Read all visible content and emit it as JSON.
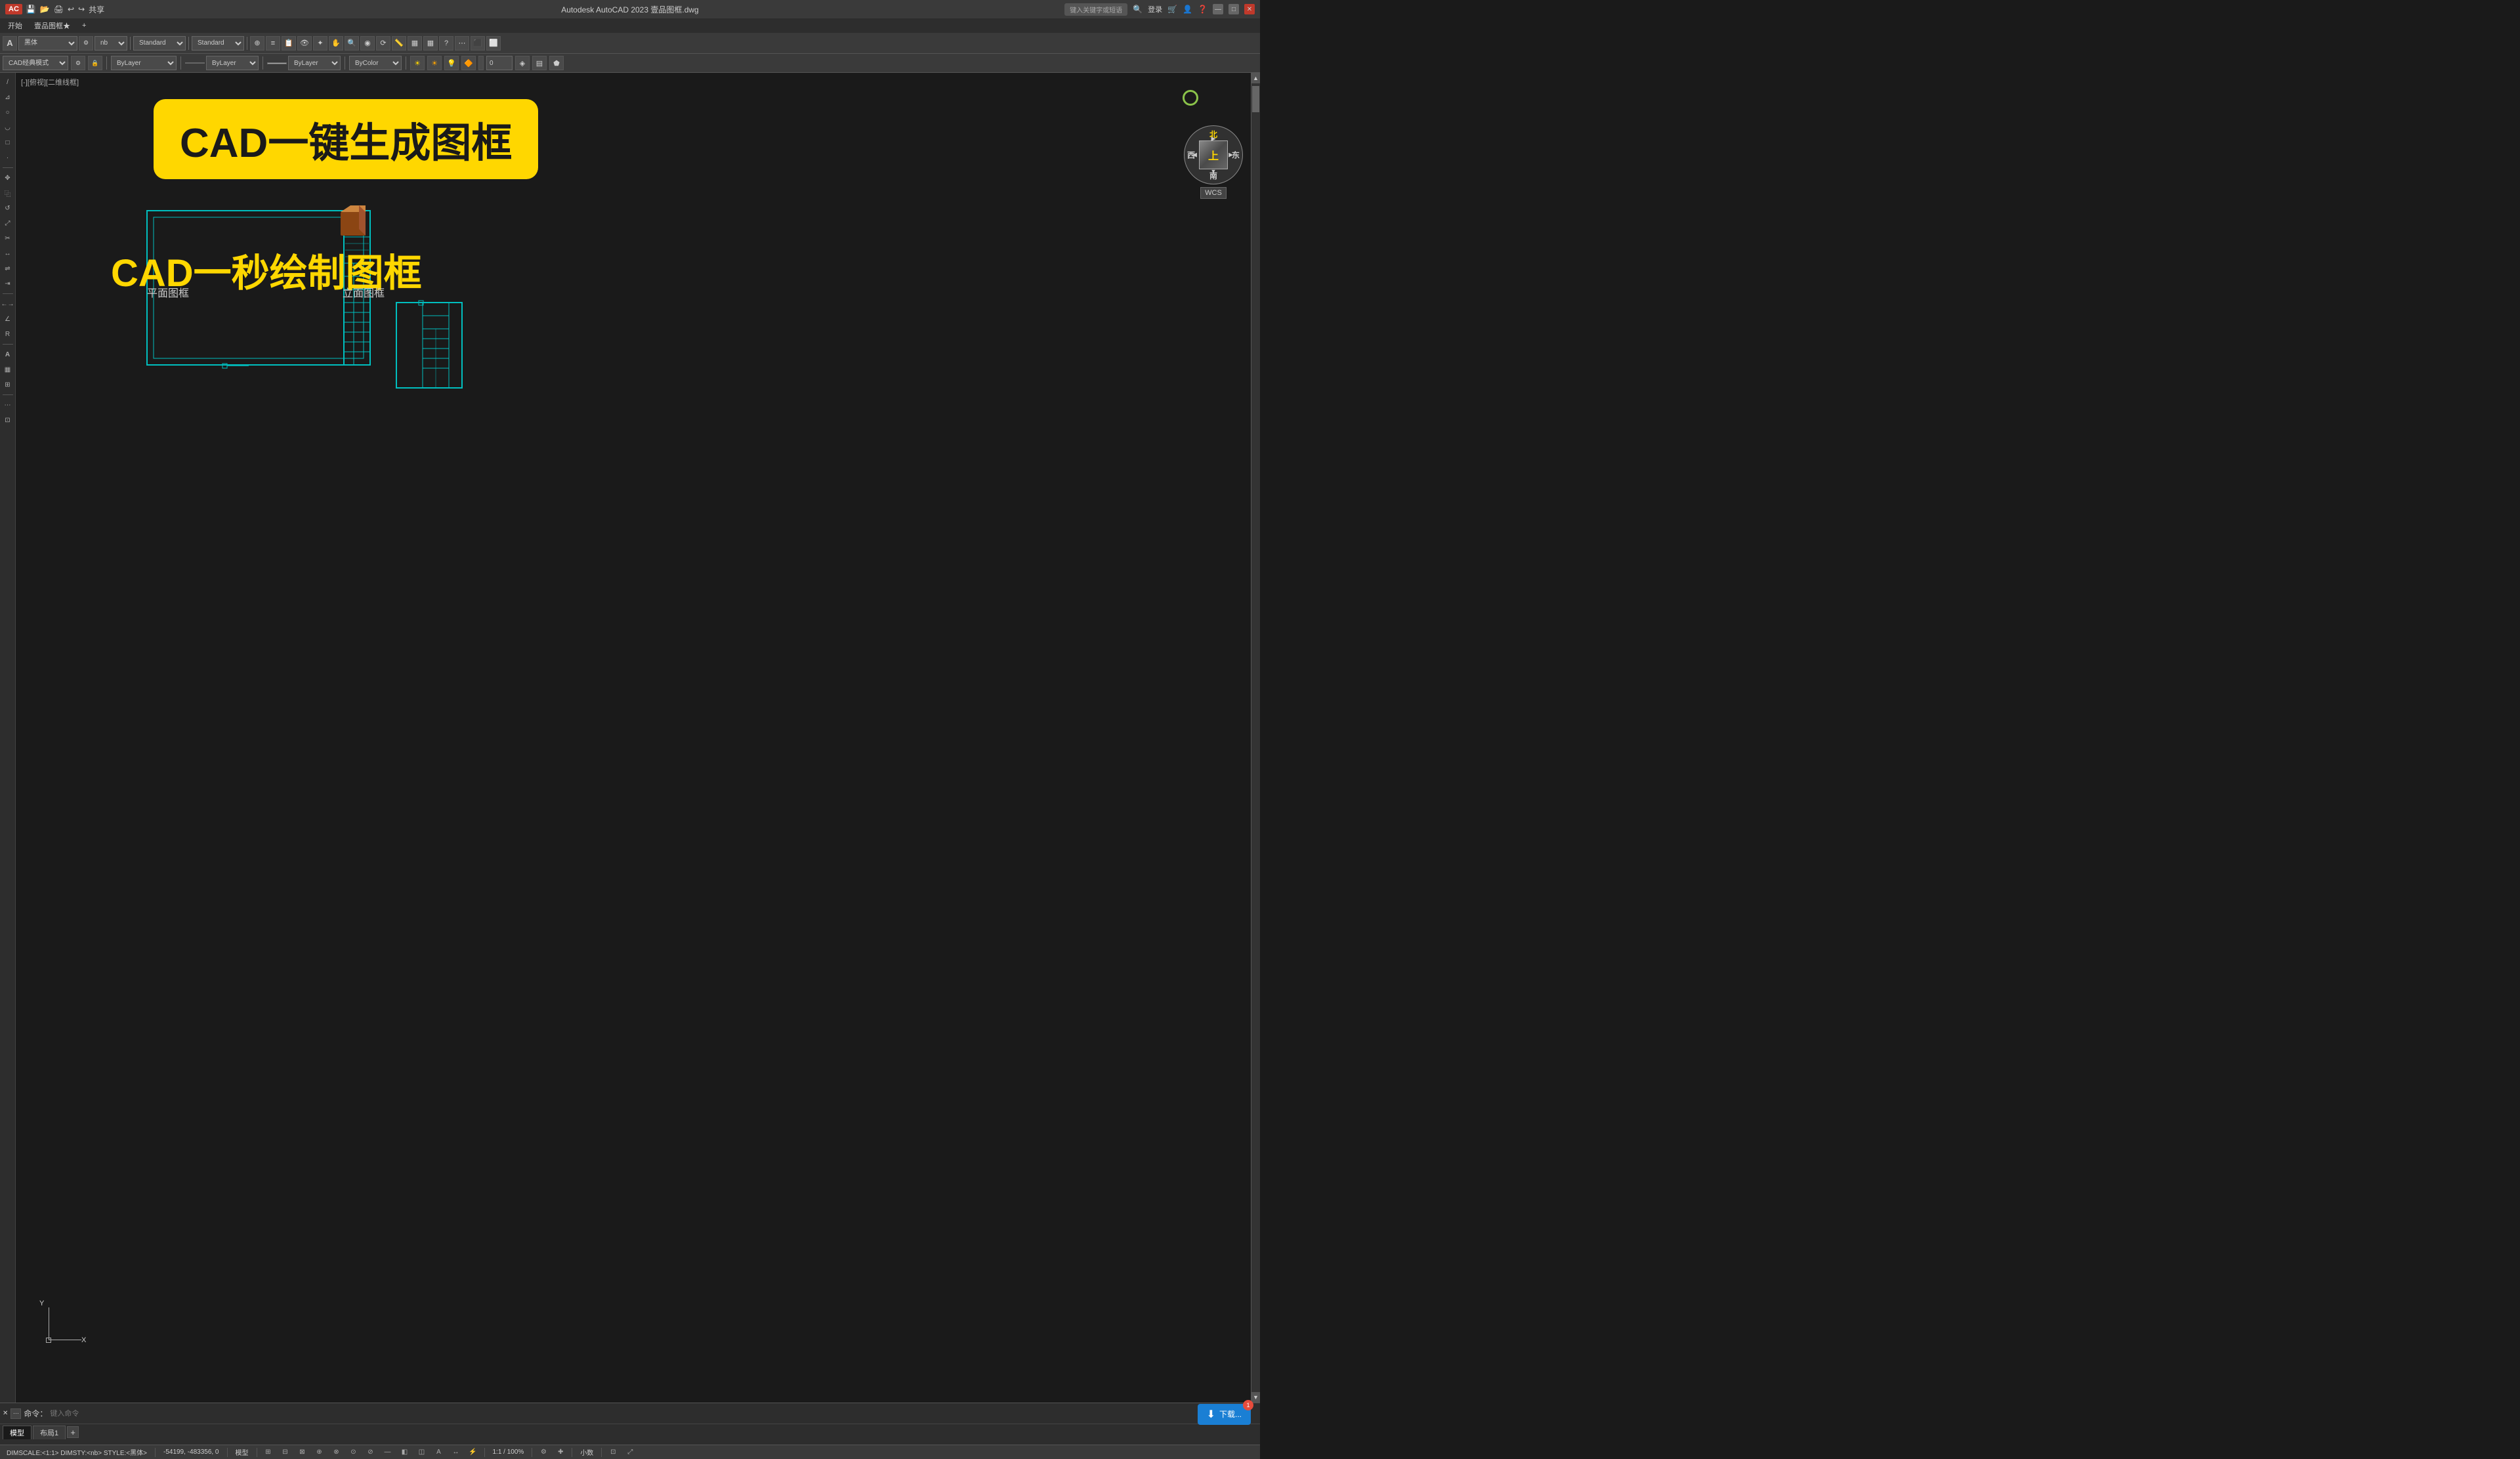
{
  "app": {
    "title": "Autodesk AutoCAD 2023  壹品图框.dwg",
    "search_placeholder": "键入关键字或短语",
    "login_label": "登录"
  },
  "title_bar": {
    "ac_label": "AC",
    "buttons": [
      "—",
      "□",
      "×"
    ]
  },
  "menu_bar": {
    "items": [
      "开始",
      "壹品图框★",
      "+"
    ]
  },
  "toolbar": {
    "font_name": "黑体",
    "font_size": "nb",
    "style1": "Standard",
    "style2": "Standard",
    "layer": "ByLayer",
    "linetype": "ByLayer",
    "lineweight": "ByLayer",
    "color": "ByColor",
    "num_value": "0"
  },
  "viewport": {
    "label": "[-][俯视][二维线框]"
  },
  "banner": {
    "text": "CAD一键生成图框"
  },
  "subtitle": {
    "main": "CAD一秒绘制图框",
    "left": "平面图框",
    "right": "立面图框"
  },
  "nav_cube": {
    "north": "北",
    "south": "南",
    "east": "东",
    "west": "西",
    "center": "上",
    "wcs": "WCS"
  },
  "command_bar": {
    "label": "命令：",
    "placeholder": "键入命令"
  },
  "tabs": {
    "items": [
      "模型",
      "布局1"
    ],
    "add": "+"
  },
  "status_bar": {
    "dim_info": "DIMSCALE:<1:1> DIMSTY:<nb> STYLE:<黑体>",
    "coords": "-54199, -483356, 0",
    "mode": "模型",
    "scale": "1:1 / 100%",
    "decimal": "小数"
  },
  "download_btn": {
    "label": "下载...",
    "badge": "1"
  },
  "cursor": {
    "visible": true
  }
}
